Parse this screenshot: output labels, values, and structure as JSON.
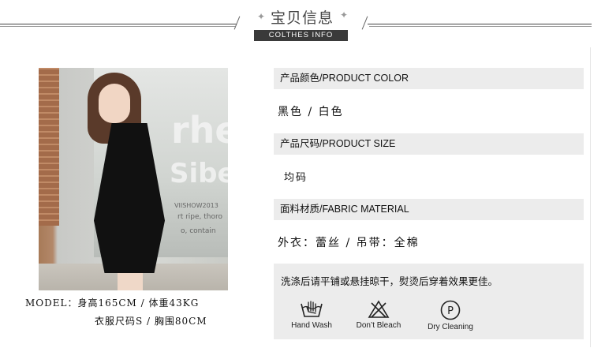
{
  "header": {
    "title": "宝贝信息",
    "subtitle": "COLTHES INFO"
  },
  "photo": {
    "sign_lines": [
      "rhe",
      "Siber",
      "VIISHOW2013",
      "rt ripe, thoro",
      "o, contain"
    ]
  },
  "model": {
    "line1": "MODEL：身高165CM / 体重43KG",
    "line2": "衣服尺码S / 胸围80CM"
  },
  "specs": [
    {
      "label": "产品颜色/PRODUCT COLOR",
      "value": "黑色 / 白色"
    },
    {
      "label": "产品尺码/PRODUCT SIZE",
      "value": "均码"
    },
    {
      "label": "面料材质/FABRIC MATERIAL",
      "value": "外衣：蕾丝 / 吊带：全棉"
    }
  ],
  "care": {
    "instruction": "洗涤后请平铺或悬挂晾干，熨烫后穿着效果更佳。",
    "icons": [
      {
        "icon": "hand-wash-icon",
        "label": "Hand Wash"
      },
      {
        "icon": "dont-bleach-icon",
        "label": "Don’t Bleach"
      },
      {
        "icon": "dry-cleaning-icon",
        "label": "Dry Cleaning"
      }
    ]
  }
}
